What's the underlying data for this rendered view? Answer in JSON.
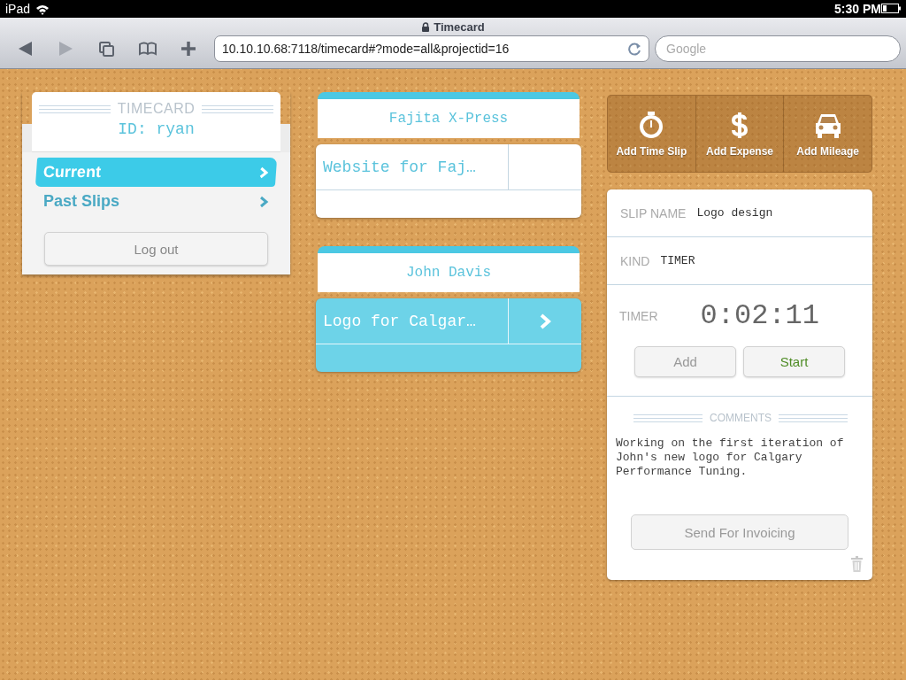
{
  "status_bar": {
    "carrier": "iPad",
    "time": "5:30 PM"
  },
  "browser": {
    "title": "Timecard",
    "secure": true,
    "url": "10.10.10.68:7118/timecard#?mode=all&projectid=16",
    "search": {
      "placeholder": "Google"
    },
    "nav": [
      {
        "kind": "back",
        "disabled": false
      },
      {
        "kind": "forward",
        "disabled": true
      },
      {
        "kind": "pages",
        "disabled": false
      },
      {
        "kind": "bookmarks",
        "disabled": false
      },
      {
        "kind": "add",
        "disabled": false
      }
    ]
  },
  "timecard": {
    "title": "TIMECARD",
    "user_id": "ID: ryan",
    "menu": [
      {
        "label": "Current",
        "selected": true
      },
      {
        "label": "Past Slips",
        "selected": false
      }
    ],
    "logout": "Log out"
  },
  "clients": [
    {
      "name": "Fajita X-Press",
      "projects": [
        {
          "name": "Website for Faj…",
          "selected": false
        }
      ]
    },
    {
      "name": "John Davis",
      "projects": [
        {
          "name": "Logo for Calgar…",
          "selected": true
        }
      ]
    }
  ],
  "actions": [
    {
      "label": "Add Time Slip",
      "kind": "timer"
    },
    {
      "label": "Add Expense",
      "kind": "dollar"
    },
    {
      "label": "Add Mileage",
      "kind": "car"
    }
  ],
  "slip": {
    "fields": [
      {
        "label": "SLIP NAME",
        "value": "Logo design"
      },
      {
        "label": "KIND",
        "value": "TIMER"
      }
    ],
    "timer": {
      "label": "TIMER",
      "value": "0:02:11",
      "buttons": [
        {
          "label": "Add",
          "kind": "plain"
        },
        {
          "label": "Start",
          "kind": "go"
        }
      ]
    },
    "comments_title": "COMMENTS",
    "comments": "Working on the first iteration of John's new logo for Calgary Performance Tuning.",
    "send": "Send For Invoicing"
  }
}
